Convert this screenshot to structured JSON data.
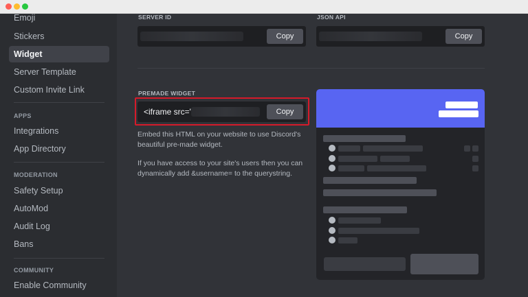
{
  "sidebar": {
    "items_top": [
      {
        "label": "Emoji"
      },
      {
        "label": "Stickers"
      },
      {
        "label": "Widget"
      },
      {
        "label": "Server Template"
      },
      {
        "label": "Custom Invite Link"
      }
    ],
    "apps_label": "APPS",
    "apps_items": [
      {
        "label": "Integrations"
      },
      {
        "label": "App Directory"
      }
    ],
    "moderation_label": "MODERATION",
    "moderation_items": [
      {
        "label": "Safety Setup"
      },
      {
        "label": "AutoMod"
      },
      {
        "label": "Audit Log"
      },
      {
        "label": "Bans"
      }
    ],
    "community_label": "COMMUNITY",
    "community_items": [
      {
        "label": "Enable Community"
      }
    ]
  },
  "main": {
    "server_id_label": "SERVER ID",
    "json_api_label": "JSON API",
    "copy_label": "Copy",
    "premade_label": "PREMADE WIDGET",
    "iframe_value": "<iframe src=\"",
    "help_1": "Embed this HTML on your website to use Discord's beautiful pre-made widget.",
    "help_2": "If you have access to your site's users then you can dynamically add &username= to the querystring."
  },
  "colors": {
    "accent": "#5865f2",
    "highlight_border": "#d71a2a",
    "sidebar_bg": "#2b2d31",
    "main_bg": "#313338"
  }
}
